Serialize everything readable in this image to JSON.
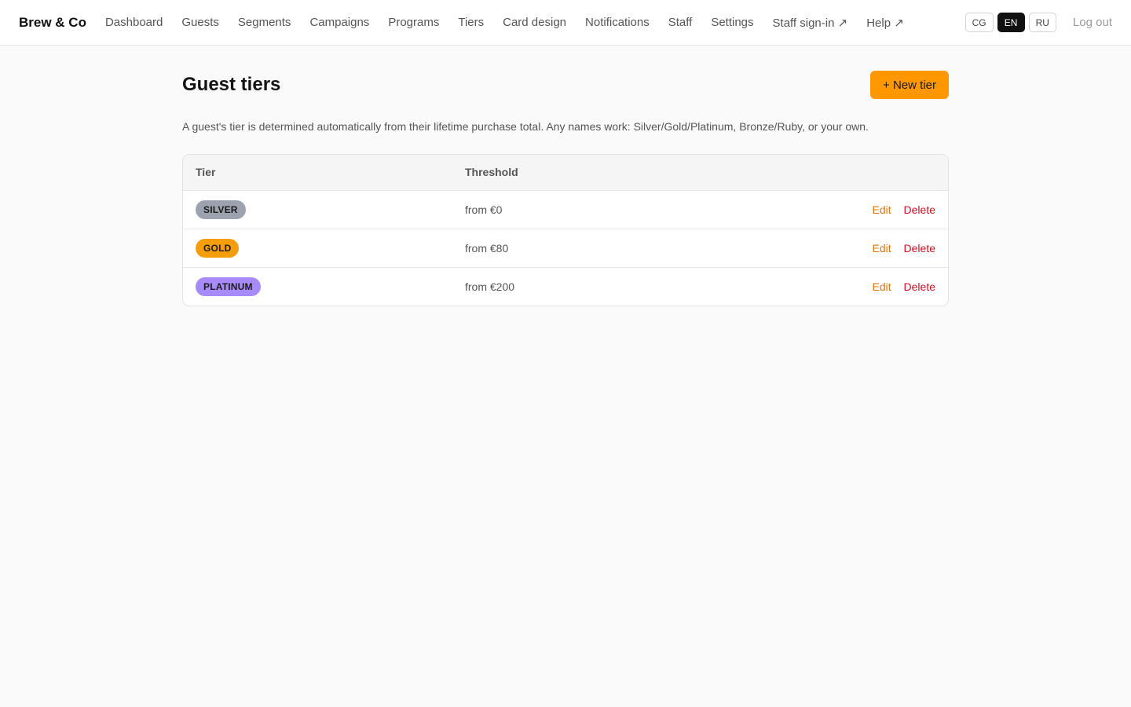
{
  "brand": "Brew & Co",
  "nav": [
    {
      "label": "Dashboard"
    },
    {
      "label": "Guests"
    },
    {
      "label": "Segments"
    },
    {
      "label": "Campaigns"
    },
    {
      "label": "Programs"
    },
    {
      "label": "Tiers"
    },
    {
      "label": "Card design"
    },
    {
      "label": "Notifications"
    },
    {
      "label": "Staff"
    },
    {
      "label": "Settings"
    },
    {
      "label": "Staff sign-in ↗"
    },
    {
      "label": "Help ↗"
    }
  ],
  "languages": [
    {
      "code": "CG",
      "selected": false
    },
    {
      "code": "EN",
      "selected": true
    },
    {
      "code": "RU",
      "selected": false
    }
  ],
  "logout_label": "Log out",
  "page": {
    "title": "Guest tiers",
    "new_button_label": "+ New tier",
    "description": "A guest's tier is determined automatically from their lifetime purchase total. Any names work: Silver/Gold/Platinum, Bronze/Ruby, or your own."
  },
  "table": {
    "headers": {
      "tier": "Tier",
      "threshold": "Threshold"
    },
    "rows": [
      {
        "tier": "SILVER",
        "color": "#9ca3af",
        "threshold": "from €0",
        "edit": "Edit",
        "delete": "Delete"
      },
      {
        "tier": "GOLD",
        "color": "#f59e0b",
        "threshold": "from €80",
        "edit": "Edit",
        "delete": "Delete"
      },
      {
        "tier": "PLATINUM",
        "color": "#a78bfa",
        "threshold": "from €200",
        "edit": "Edit",
        "delete": "Delete"
      }
    ]
  },
  "colors": {
    "accent": "#ff9800",
    "edit_link": "#d97706",
    "delete_link": "#cc1122"
  }
}
